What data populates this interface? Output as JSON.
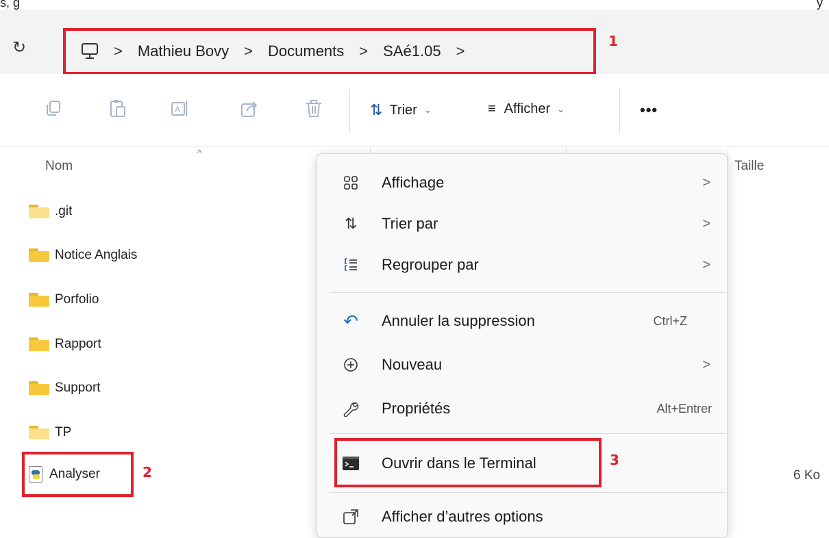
{
  "top_strip": {
    "fragment_left": "s, g",
    "fragment_right": "y"
  },
  "address_bar": {
    "items": [
      "Mathieu Bovy",
      "Documents",
      "SAé1.05"
    ],
    "separator": ">",
    "icons": {
      "refresh": "refresh-icon",
      "root": "computer-icon"
    }
  },
  "markers": {
    "one": "1",
    "two": "2",
    "three": "3"
  },
  "toolbar": {
    "sort_label": "Trier",
    "view_label": "Afficher",
    "more_label": "•••",
    "icons": [
      "copy-icon",
      "paste-icon",
      "rename-icon",
      "share-icon",
      "delete-icon"
    ]
  },
  "file_list": {
    "columns": {
      "name": "Nom",
      "size": "Taille"
    },
    "items": [
      {
        "name": ".git",
        "type": "folder-empty"
      },
      {
        "name": "Notice Anglais",
        "type": "folder"
      },
      {
        "name": "Porfolio",
        "type": "folder"
      },
      {
        "name": "Rapport",
        "type": "folder"
      },
      {
        "name": "Support",
        "type": "folder"
      },
      {
        "name": "TP",
        "type": "folder-empty"
      },
      {
        "name": "Analyser",
        "type": "python-file",
        "size": "6 Ko"
      }
    ]
  },
  "context_menu": {
    "items": [
      {
        "label": "Affichage",
        "icon": "grid-view-icon",
        "submenu": true
      },
      {
        "label": "Trier par",
        "icon": "sort-icon",
        "submenu": true
      },
      {
        "label": "Regrouper par",
        "icon": "group-by-icon",
        "submenu": true
      },
      {
        "label": "Annuler la suppression",
        "icon": "undo-icon",
        "shortcut": "Ctrl+Z"
      },
      {
        "label": "Nouveau",
        "icon": "new-plus-icon",
        "submenu": true
      },
      {
        "label": "Propriétés",
        "icon": "wrench-icon",
        "shortcut": "Alt+Entrer"
      },
      {
        "label": "Ouvrir dans le Terminal",
        "icon": "terminal-icon"
      },
      {
        "label": "Afficher d’autres options",
        "icon": "more-options-icon"
      }
    ],
    "chevron": ">"
  },
  "colors": {
    "highlight_red": "#e0202d",
    "folder_yellow": "#f8c83c",
    "background_gray": "#f3f3f3"
  }
}
